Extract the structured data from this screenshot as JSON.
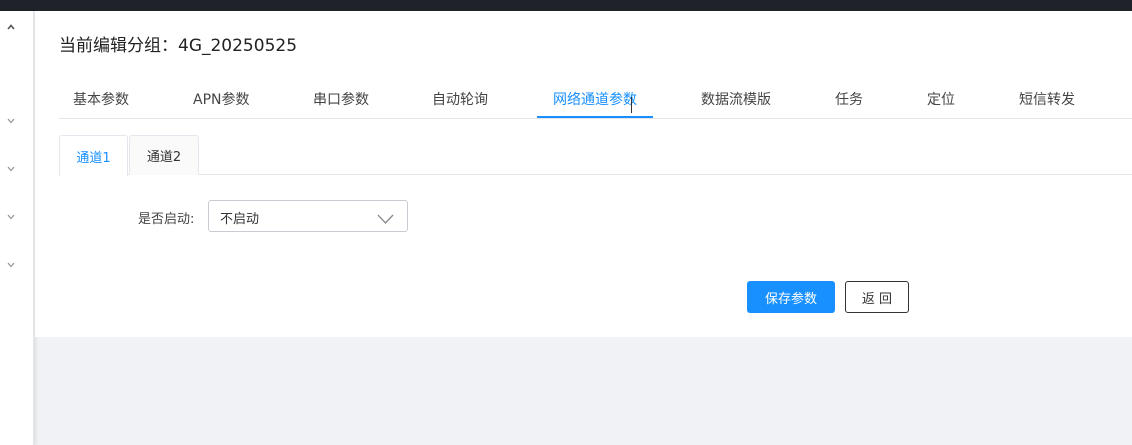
{
  "header": {
    "title_prefix": "当前编辑分组：",
    "group_name": "4G_20250525"
  },
  "tabs": [
    {
      "label": "基本参数"
    },
    {
      "label": "APN参数"
    },
    {
      "label": "串口参数"
    },
    {
      "label": "自动轮询"
    },
    {
      "label": "网络通道参数",
      "active": true
    },
    {
      "label": "数据流模版"
    },
    {
      "label": "任务"
    },
    {
      "label": "定位"
    },
    {
      "label": "短信转发"
    }
  ],
  "subtabs": [
    {
      "label": "通道1",
      "active": true
    },
    {
      "label": "通道2"
    }
  ],
  "form": {
    "enable_label": "是否启动:",
    "enable_value": "不启动"
  },
  "buttons": {
    "save_label": "保存参数",
    "back_label": "返 回"
  },
  "colors": {
    "accent": "#1890ff",
    "topbar": "#1f2229",
    "page_bg": "#f0f2f5"
  },
  "icons": {
    "sidebar_collapse": "chevron-up-icon",
    "sidebar_expand": "chevron-down-icon",
    "select_arrow": "chevron-down-icon"
  }
}
